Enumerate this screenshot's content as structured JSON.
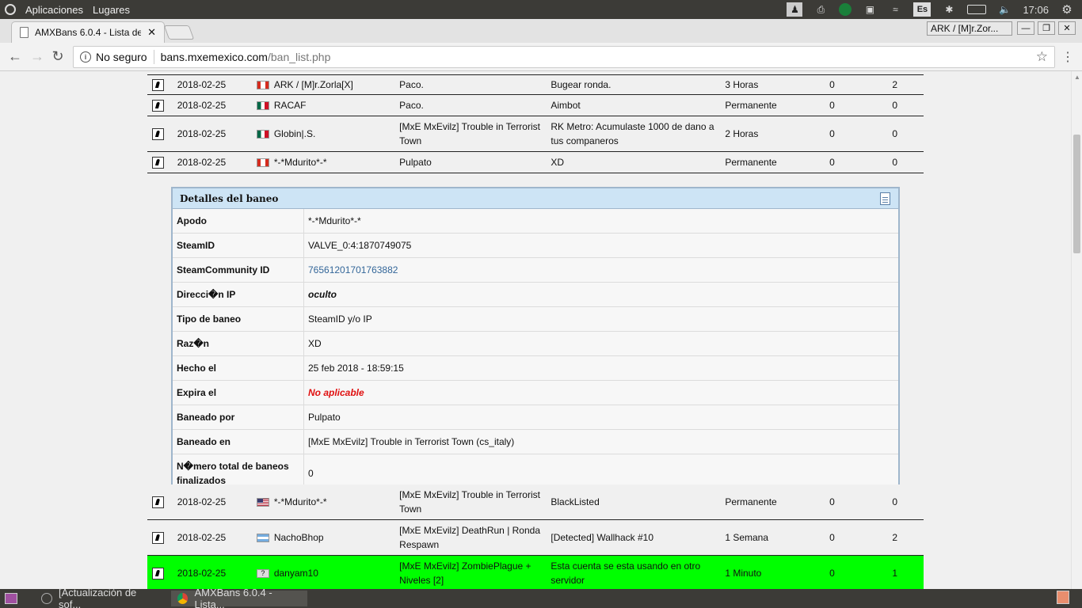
{
  "top_panel": {
    "menu_apps": "Aplicaciones",
    "menu_places": "Lugares",
    "keyboard": "Es",
    "time": "17:06"
  },
  "browser": {
    "tab_title": "AMXBans 6.0.4 - Lista de",
    "window_title": "ARK / [M]r.Zor...",
    "insecure_label": "No seguro",
    "url_host": "bans.mxemexico.com",
    "url_path": "/ban_list.php"
  },
  "ban_rows_top": [
    {
      "date": "2018-02-25",
      "flag": "ca",
      "nick": "ARK / [M]r.Zorla[X]",
      "server": "Paco.",
      "reason": "Bugear ronda.",
      "length": "3 Horas",
      "kicks": "0",
      "others": "2"
    },
    {
      "date": "2018-02-25",
      "flag": "mx",
      "nick": "RACAF",
      "server": "Paco.",
      "reason": "Aimbot",
      "length": "Permanente",
      "kicks": "0",
      "others": "0"
    },
    {
      "date": "2018-02-25",
      "flag": "mx",
      "nick": "Globin|.S.",
      "server": "[MxE MxEvilz] Trouble in Terrorist Town",
      "reason": "RK Metro: Acumulaste 1000 de dano a tus companeros",
      "length": "2 Horas",
      "kicks": "0",
      "others": "0"
    },
    {
      "date": "2018-02-25",
      "flag": "ca",
      "nick": "*-*Mdurito*-*",
      "server": "Pulpato",
      "reason": "XD",
      "length": "Permanente",
      "kicks": "0",
      "others": "0"
    }
  ],
  "details": {
    "title": "Detalles del baneo",
    "rows": [
      {
        "label": "Apodo",
        "value": "*-*Mdurito*-*",
        "style": ""
      },
      {
        "label": "SteamID",
        "value": "VALVE_0:4:1870749075",
        "style": ""
      },
      {
        "label": "SteamCommunity ID",
        "value": "76561201701763882",
        "style": "link"
      },
      {
        "label": "Direcci�n IP",
        "value": "oculto",
        "style": "hidden"
      },
      {
        "label": "Tipo de baneo",
        "value": "SteamID y/o IP",
        "style": ""
      },
      {
        "label": "Raz�n",
        "value": "XD",
        "style": ""
      },
      {
        "label": "Hecho el",
        "value": "25 feb 2018 - 18:59:15",
        "style": ""
      },
      {
        "label": "Expira el",
        "value": "No aplicable",
        "style": "red"
      },
      {
        "label": "Baneado por",
        "value": "Pulpato",
        "style": ""
      },
      {
        "label": "Baneado en",
        "value": "[MxE MxEvilz] Trouble in Terrorist Town (cs_italy)",
        "style": ""
      },
      {
        "label": "N�mero total de baneos finalizados",
        "value": "0",
        "style": ""
      }
    ]
  },
  "ban_rows_bottom": [
    {
      "date": "2018-02-25",
      "flag": "us",
      "nick": "*-*Mdurito*-*",
      "server": "[MxE MxEvilz] Trouble in Terrorist Town",
      "reason": "BlackListed",
      "length": "Permanente",
      "kicks": "0",
      "others": "0",
      "highlight": false
    },
    {
      "date": "2018-02-25",
      "flag": "ar",
      "nick": "NachoBhop",
      "server": "[MxE MxEvilz] DeathRun | Ronda Respawn",
      "reason": "[Detected] Wallhack #10",
      "length": "1 Semana",
      "kicks": "0",
      "others": "2",
      "highlight": false
    },
    {
      "date": "2018-02-25",
      "flag": "unk",
      "nick": "danyam10",
      "server": "[MxE MxEvilz] ZombiePlague + Niveles [2]",
      "reason": "Esta cuenta se esta usando en otro servidor",
      "length": "1 Minuto",
      "kicks": "0",
      "others": "1",
      "highlight": true
    }
  ],
  "taskbar": {
    "task1": "[Actualización de sof...",
    "task2": "AMXBans 6.0.4 - Lista..."
  }
}
